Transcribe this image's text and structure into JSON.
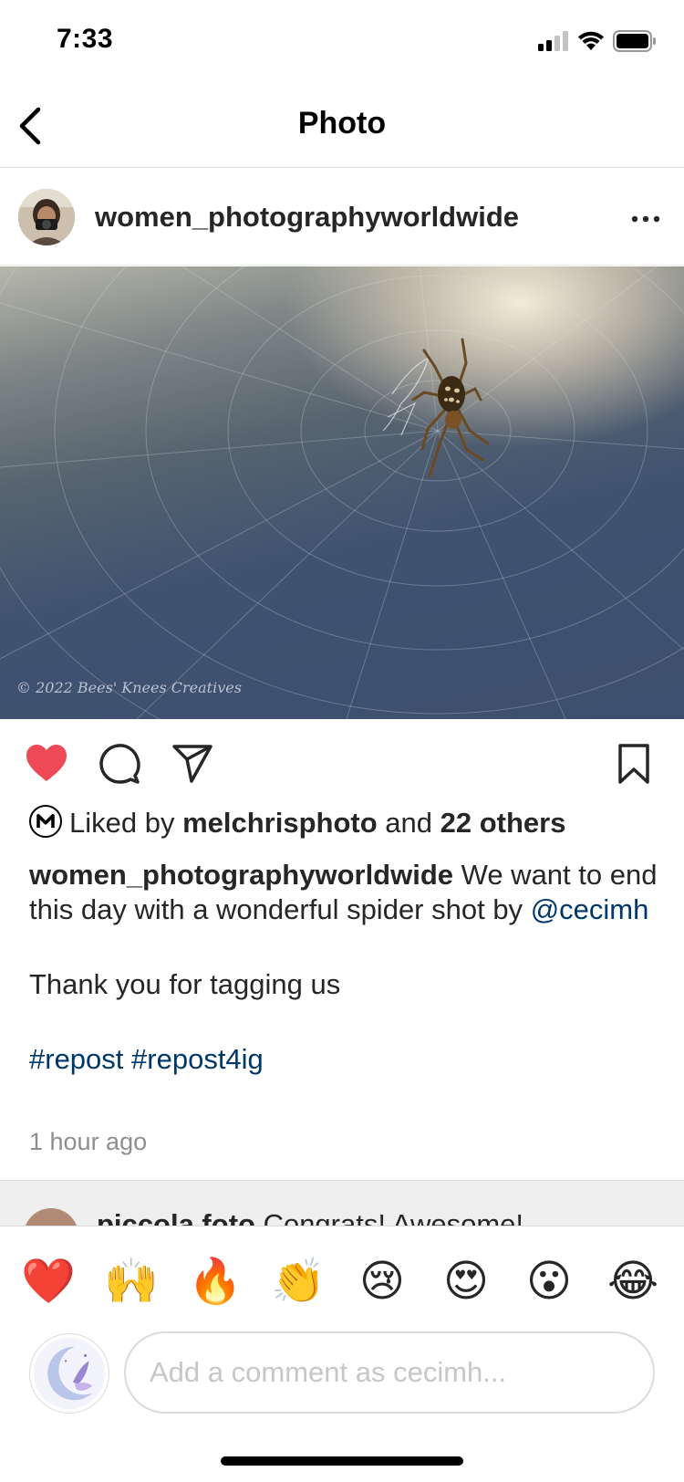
{
  "status_bar": {
    "time": "7:33"
  },
  "nav": {
    "title": "Photo"
  },
  "post": {
    "username": "women_photographyworldwide",
    "photo_watermark": "© 2022 Bees' Knees Creatives",
    "liked_by_prefix": "Liked by ",
    "liked_by_user": "melchrisphoto",
    "liked_by_and": " and ",
    "liked_by_others": "22 others",
    "caption_user": "women_photographyworldwide",
    "caption_text": " We want to end this day with a wonderful spider shot by ",
    "caption_mention": "@cecimh",
    "caption_thanks": "Thank you for tagging us",
    "hashtag_1": "#repost",
    "hashtag_2": "#repost4ig",
    "time_ago": "1 hour ago"
  },
  "comment_preview": {
    "username": "piccola.foto",
    "text": " Congrats! Awesome!"
  },
  "composer": {
    "emojis": [
      "❤️",
      "🙌",
      "🔥",
      "👏",
      "😢",
      "😍",
      "😮",
      "😂"
    ],
    "placeholder": "Add a comment as cecimh..."
  },
  "colors": {
    "like_red": "#ed4956",
    "link_blue": "#00376b",
    "muted_gray": "#8e8e8e"
  }
}
